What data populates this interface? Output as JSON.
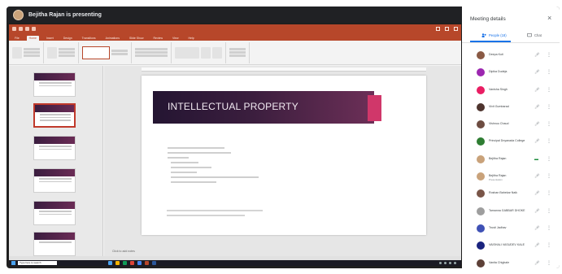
{
  "presenter": {
    "text": "Bejitha Rajan is presenting"
  },
  "ppt": {
    "tabs": [
      "File",
      "Home",
      "Insert",
      "Design",
      "Transitions",
      "Animations",
      "Slide Show",
      "Review",
      "View",
      "Help"
    ],
    "active_tab": "Home",
    "slide_title": "INTELLECTUAL PROPERTY",
    "notes_label": "Click to add notes",
    "taskbar_search": "Type here to search"
  },
  "panel": {
    "title": "Meeting details",
    "tabs": {
      "people": "People (18)",
      "chat": "Chat"
    },
    "participants": [
      {
        "name": "Deepa Kuti",
        "avatar": "#8a5a44",
        "mic": "muted"
      },
      {
        "name": "Dipika Dudeja",
        "avatar": "#9c27b0",
        "mic": "muted"
      },
      {
        "name": "Vanisha Singh",
        "avatar": "#e91e63",
        "mic": "muted"
      },
      {
        "name": "Vivit Gumbarad",
        "avatar": "#4e342e",
        "mic": "muted"
      },
      {
        "name": "Vishnuu Chaud",
        "avatar": "#6d4c41",
        "mic": "muted"
      },
      {
        "name": "Principal Dnyanada College",
        "avatar": "#2e7d32",
        "mic": "muted"
      },
      {
        "name": "Bejitha Rajan",
        "avatar": "#c9a27a",
        "mic": "live"
      },
      {
        "name": "Bejitha Rajan",
        "sub": "Presentation",
        "avatar": "#c9a27a",
        "mic": "muted"
      },
      {
        "name": "Roshan Bahekar Naik",
        "avatar": "#795548",
        "mic": "muted"
      },
      {
        "name": "Tamanna GABBAR DHOKE",
        "avatar": "#9e9e9e",
        "mic": "muted"
      },
      {
        "name": "Trusti Jadhav",
        "avatar": "#3f51b5",
        "mic": "muted"
      },
      {
        "name": "VAISHALI VASUDEV KALE",
        "avatar": "#1a237e",
        "mic": "muted"
      },
      {
        "name": "Vanita Chighale",
        "avatar": "#5d4037",
        "mic": "muted"
      }
    ]
  }
}
